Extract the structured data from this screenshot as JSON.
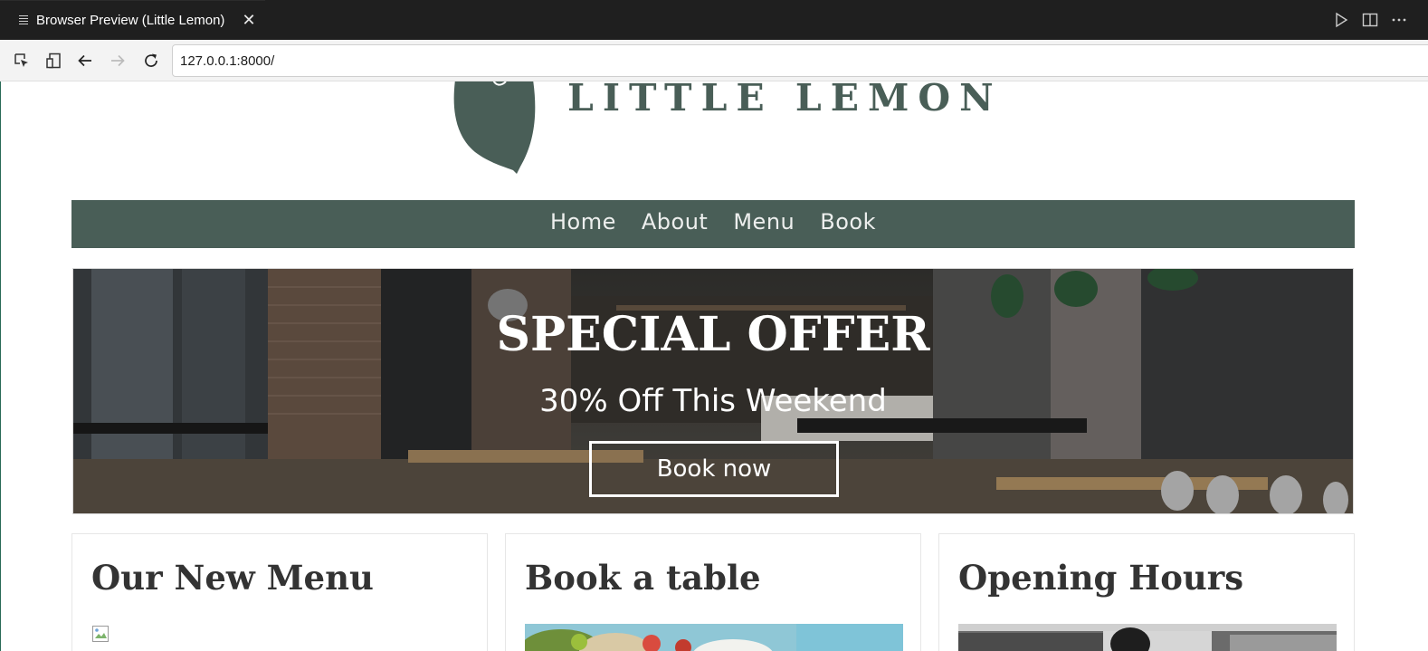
{
  "tab": {
    "title": "Browser Preview (Little Lemon)",
    "close_glyph": "✕",
    "icon": "preview-icon"
  },
  "tab_actions": [
    "run-icon",
    "split-editor-icon",
    "more-icon"
  ],
  "toolbar": {
    "icons": [
      "inspect-icon",
      "device-toggle-icon",
      "back-arrow-icon",
      "forward-arrow-icon",
      "reload-icon"
    ]
  },
  "address": {
    "url": "127.0.0.1:8000/"
  },
  "site": {
    "logo_text": "LITTLE LEMON",
    "nav": [
      "Home",
      "About",
      "Menu",
      "Book"
    ],
    "hero": {
      "title": "SPECIAL OFFER",
      "subtitle": "30% Off This Weekend",
      "button": "Book now"
    },
    "cards": [
      {
        "title": "Our New Menu",
        "image": "broken-image-icon"
      },
      {
        "title": "Book a table",
        "image": "salad-photo"
      },
      {
        "title": "Opening Hours",
        "image": "kitchen-photo"
      }
    ]
  },
  "colors": {
    "brand": "#495e57",
    "nav_text": "#edefee",
    "tabbar": "#1f1f1f",
    "toolbar": "#f3f3f3"
  }
}
